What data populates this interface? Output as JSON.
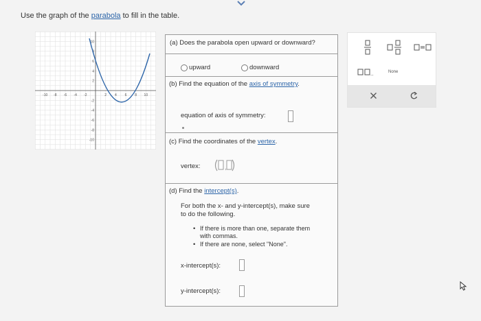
{
  "instruction": {
    "prefix": "Use the graph of the ",
    "link": "parabola",
    "suffix": " to fill in the table."
  },
  "graph": {
    "x_ticks": [
      "-10",
      "-8",
      "-6",
      "-4",
      "-2",
      "2",
      "4",
      "6",
      "8",
      "10"
    ],
    "y_ticks": [
      "10",
      "8",
      "6",
      "4",
      "2",
      "-2",
      "-4",
      "-6",
      "-8",
      "-10"
    ]
  },
  "part_a": {
    "question": "(a) Does the parabola open upward or downward?",
    "option_upward": "upward",
    "option_downward": "downward"
  },
  "part_b": {
    "prefix": "(b) Find the equation of the ",
    "link": "axis of symmetry",
    "suffix": ".",
    "answer_label": "equation of axis of symmetry:"
  },
  "part_c": {
    "prefix": "(c) Find the coordinates of the ",
    "link": "vertex",
    "suffix": ".",
    "answer_label": "vertex:"
  },
  "part_d": {
    "prefix": "(d) Find the ",
    "link": "intercept(s)",
    "suffix": ".",
    "instr_line1": "For both the x- and y-intercept(s), make sure",
    "instr_line2": "to do the following.",
    "bullet1_line1": "If there is more than one, separate them",
    "bullet1_line2": "with commas.",
    "bullet2": "If there are none, select \"None\".",
    "x_label": "x-intercept(s):",
    "y_label": "y-intercept(s):"
  },
  "palette": {
    "none_label": "None",
    "clear_icon": "x-icon",
    "undo_icon": "undo-icon"
  }
}
